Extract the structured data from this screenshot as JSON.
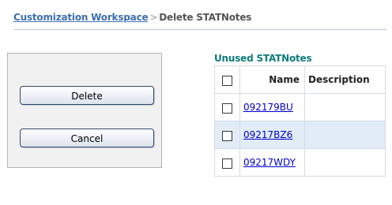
{
  "breadcrumb": {
    "parent_label": "Customization Workspace",
    "separator": ">",
    "current": "Delete STATNotes"
  },
  "actions": {
    "delete_label": "Delete",
    "cancel_label": "Cancel"
  },
  "notes_section": {
    "title": "Unused STATNotes",
    "columns": {
      "name": "Name",
      "description": "Description"
    },
    "rows": [
      {
        "name": "092179BU",
        "description": "",
        "checked": false
      },
      {
        "name": "09217BZ6",
        "description": "",
        "checked": false
      },
      {
        "name": "09217WDY",
        "description": "",
        "checked": false
      }
    ]
  },
  "colors": {
    "link": "#3d6fb0",
    "section_title": "#0f7c7c",
    "row_highlight": "#e1ecf7",
    "panel_bg": "#f1f1f1"
  }
}
